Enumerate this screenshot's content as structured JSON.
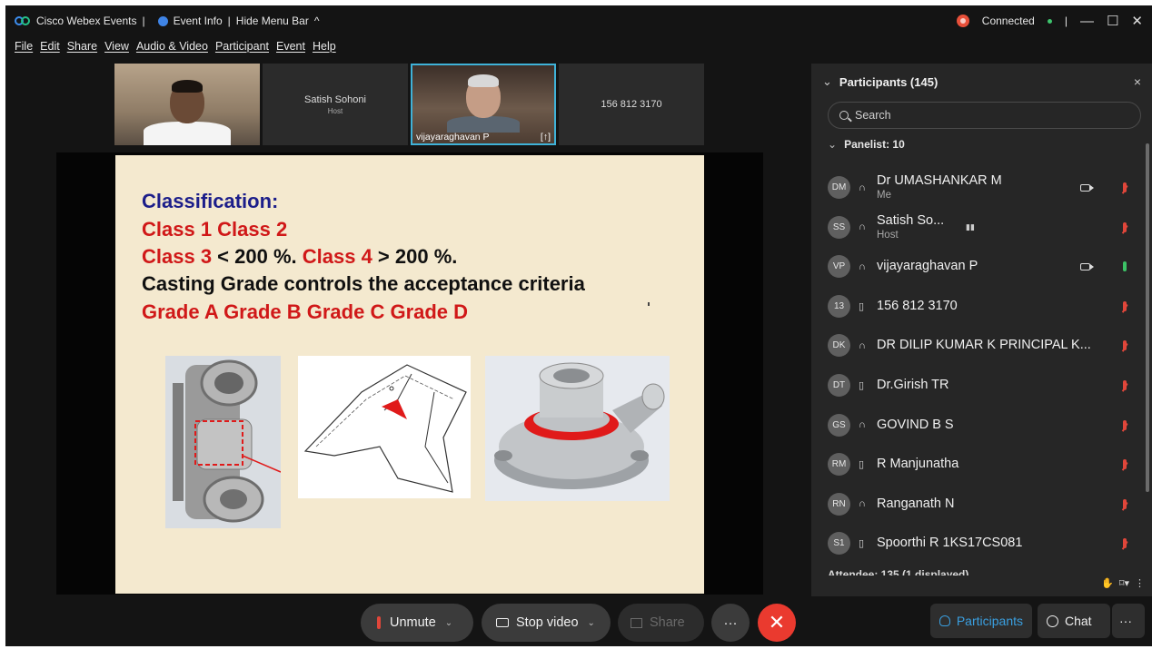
{
  "titlebar": {
    "app_name": "Cisco Webex Events",
    "sep1": "|",
    "event_info": "Event Info",
    "sep2": "|",
    "hide_menu": "Hide Menu Bar",
    "chevron": "^",
    "connection": "Connected",
    "sep3": "|",
    "minimize": "—",
    "maximize": "☐",
    "close": "✕"
  },
  "menu": [
    "File",
    "Edit",
    "Share",
    "View",
    "Audio & Video",
    "Participant",
    "Event",
    "Help"
  ],
  "tiles": [
    {
      "name": "",
      "role": ""
    },
    {
      "name": "Satish Sohoni",
      "role": "Host"
    },
    {
      "name": "vijayaraghavan P",
      "role": "",
      "badge": "[↑]"
    },
    {
      "name": "156 812 3170",
      "role": ""
    }
  ],
  "slide": {
    "line1": "Classification:",
    "line2": "Class 1   Class 2",
    "line3_a": "Class 3",
    "line3_b": " < 200 %. ",
    "line3_c": "Class 4",
    "line3_d": " > 200 %.",
    "line4": "Casting Grade controls the acceptance criteria",
    "line5": "Grade A  Grade B  Grade C  Grade D"
  },
  "panel": {
    "title": "Participants (145)",
    "close": "×",
    "search_placeholder": "Search",
    "panelist_group": "Panelist: 10",
    "attendee_group": "Attendee: 135 (1 displayed)",
    "participants": [
      {
        "initials": "DM",
        "name": "Dr UMASHANKAR M",
        "sub": "Me",
        "device": "phone",
        "video": true,
        "mic_on": false
      },
      {
        "initials": "SS",
        "name": "Satish So...",
        "sub": "Host",
        "device": "phone",
        "video": false,
        "mic_on": false
      },
      {
        "initials": "VP",
        "name": "vijayaraghavan P",
        "sub": "",
        "device": "phone",
        "video": true,
        "mic_on": true
      },
      {
        "initials": "13",
        "name": "156 812 3170",
        "sub": "",
        "device": "desk",
        "video": false,
        "mic_on": false
      },
      {
        "initials": "DK",
        "name": "DR DILIP KUMAR K PRINCIPAL K...",
        "sub": "",
        "device": "phone",
        "video": false,
        "mic_on": false
      },
      {
        "initials": "DT",
        "name": "Dr.Girish TR",
        "sub": "",
        "device": "desk",
        "video": false,
        "mic_on": false
      },
      {
        "initials": "GS",
        "name": "GOVIND B S",
        "sub": "",
        "device": "phone",
        "video": false,
        "mic_on": false
      },
      {
        "initials": "RM",
        "name": "R Manjunatha",
        "sub": "",
        "device": "desk",
        "video": false,
        "mic_on": false
      },
      {
        "initials": "RN",
        "name": "Ranganath N",
        "sub": "",
        "device": "phone",
        "video": false,
        "mic_on": false
      },
      {
        "initials": "S1",
        "name": "Spoorthi R 1KS17CS081",
        "sub": "",
        "device": "desk",
        "video": false,
        "mic_on": false
      }
    ]
  },
  "controls": {
    "unmute": "Unmute",
    "stop_video": "Stop video",
    "share": "Share",
    "more": "···",
    "leave": "✕",
    "participants": "Participants",
    "chat": "Chat",
    "side_more": "···"
  },
  "colors": {
    "accent": "#3a9fe0",
    "leave": "#ea3a2f",
    "muted": "#e0463a",
    "unmuted": "#3cc266"
  }
}
